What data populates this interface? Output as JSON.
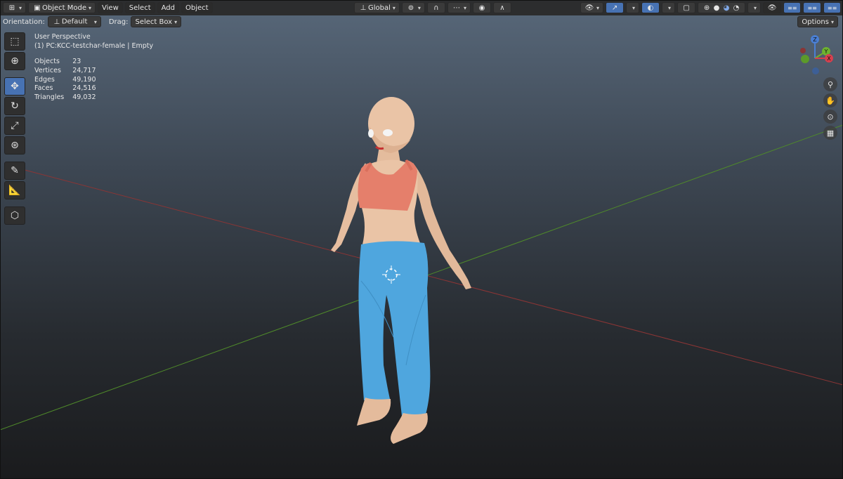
{
  "header": {
    "mode": "Object Mode",
    "menus": [
      "View",
      "Select",
      "Add",
      "Object"
    ],
    "transform_orientation": "Global",
    "options_label": "Options"
  },
  "subheader": {
    "orientation_label": "Orientation:",
    "orientation_value": "Default",
    "drag_label": "Drag:",
    "drag_value": "Select Box"
  },
  "overlay": {
    "view_name": "User Perspective",
    "context": "(1) PC:KCC-testchar-female | Empty"
  },
  "stats": [
    {
      "label": "Objects",
      "value": "23"
    },
    {
      "label": "Vertices",
      "value": "24,717"
    },
    {
      "label": "Edges",
      "value": "49,190"
    },
    {
      "label": "Faces",
      "value": "24,516"
    },
    {
      "label": "Triangles",
      "value": "49,032"
    }
  ],
  "gizmo": {
    "z": "Z",
    "y": "Y",
    "x": "X"
  },
  "colors": {
    "active_tool": "#4772b3",
    "x_axis": "#a83b3b",
    "y_axis": "#5a9b2e",
    "top_color": "#e8806f",
    "pants_color": "#4ea3dc",
    "skin_color": "#e9c3a4"
  },
  "tools": [
    "select-box-icon",
    "cursor-icon",
    "move-icon",
    "rotate-icon",
    "scale-icon",
    "transform-icon",
    "annotate-icon",
    "measure-icon",
    "add-cube-icon"
  ]
}
